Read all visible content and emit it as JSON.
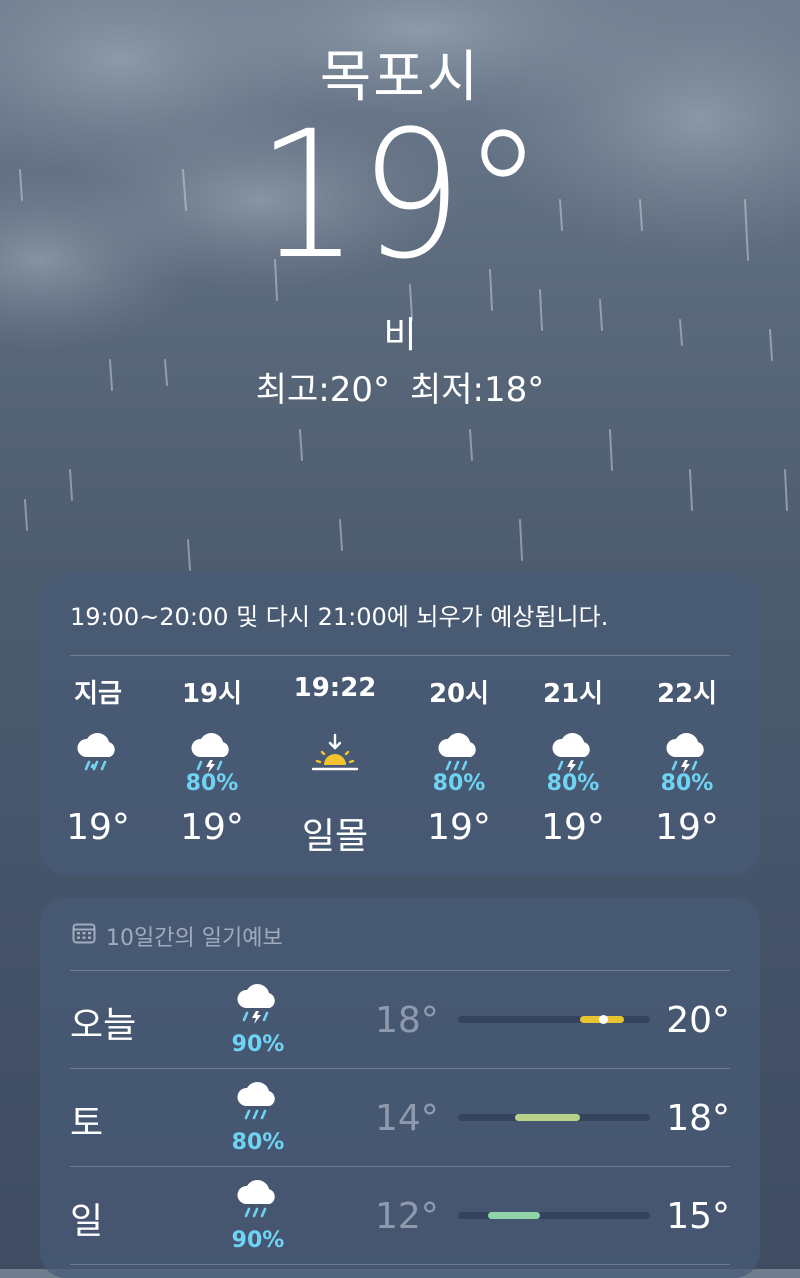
{
  "location": "목포시",
  "current": {
    "temperature": "19°",
    "condition": "비",
    "high": "최고:20°",
    "low": "최저:18°"
  },
  "hourly": {
    "summary": "19:00~20:00 및 다시 21:00에 뇌우가 예상됩니다.",
    "items": [
      {
        "label": "지금",
        "icon": "cloud-rain-icon",
        "precip": "",
        "value": "19°"
      },
      {
        "label": "19시",
        "icon": "cloud-bolt-rain-icon",
        "precip": "80%",
        "value": "19°"
      },
      {
        "label": "19:22",
        "icon": "sunset-icon",
        "precip": "",
        "value": "일몰"
      },
      {
        "label": "20시",
        "icon": "cloud-rain-icon",
        "precip": "80%",
        "value": "19°"
      },
      {
        "label": "21시",
        "icon": "cloud-bolt-rain-icon",
        "precip": "80%",
        "value": "19°"
      },
      {
        "label": "22시",
        "icon": "cloud-bolt-rain-icon",
        "precip": "80%",
        "value": "19°"
      }
    ]
  },
  "daily": {
    "title": "10일간의 일기예보",
    "days": [
      {
        "day": "오늘",
        "icon": "cloud-bolt-rain-icon",
        "precip": "90%",
        "low": "18°",
        "high": "20°",
        "range_color": "#e8c431"
      },
      {
        "day": "토",
        "icon": "cloud-rain-icon",
        "precip": "80%",
        "low": "14°",
        "high": "18°",
        "range_color": "#b9d28a"
      },
      {
        "day": "일",
        "icon": "cloud-rain-icon",
        "precip": "90%",
        "low": "12°",
        "high": "15°",
        "range_color": "#8fd4a8"
      }
    ]
  },
  "colors": {
    "precip": "#6fd4f4",
    "sun": "#f4c430"
  }
}
